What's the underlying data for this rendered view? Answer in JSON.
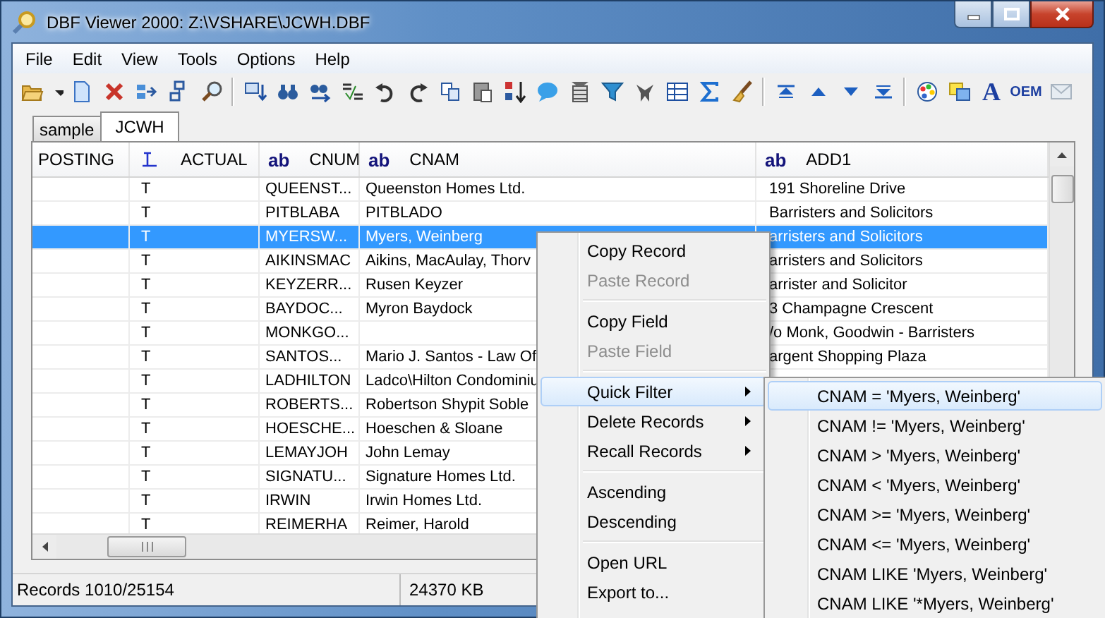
{
  "window": {
    "title": "DBF Viewer 2000: Z:\\VSHARE\\JCWH.DBF"
  },
  "menu_bar": [
    "File",
    "Edit",
    "View",
    "Tools",
    "Options",
    "Help"
  ],
  "toolbar": {
    "font_button": "A",
    "oem_button": "OEM"
  },
  "tabs": [
    {
      "label": "sample",
      "selected": false
    },
    {
      "label": "JCWH",
      "selected": true
    }
  ],
  "table": {
    "columns": [
      {
        "label": "POSTING",
        "kind": "plain"
      },
      {
        "label": "ACTUAL",
        "kind": "logical"
      },
      {
        "label": "CNUM",
        "kind": "text",
        "type_label": "ab"
      },
      {
        "label": "CNAM",
        "kind": "text",
        "type_label": "ab"
      },
      {
        "label": "ADD1",
        "kind": "text",
        "type_label": "ab"
      }
    ],
    "rows": [
      {
        "actual": "T",
        "cnum": "QUEENST...",
        "cnam": "Queenston Homes Ltd.",
        "add1": "191 Shoreline Drive",
        "selected": false
      },
      {
        "actual": "T",
        "cnum": "PITBLABA",
        "cnam": "PITBLADO",
        "add1": "Barristers and Solicitors",
        "selected": false
      },
      {
        "actual": "T",
        "cnum": "MYERSW...",
        "cnam": "Myers, Weinberg",
        "add1": "arristers and Solicitors",
        "selected": true
      },
      {
        "actual": "T",
        "cnum": "AIKINSMAC",
        "cnam": "Aikins, MacAulay, Thorv",
        "add1": "arristers and Solicitors",
        "selected": false
      },
      {
        "actual": "T",
        "cnum": "KEYZERR...",
        "cnam": "Rusen Keyzer",
        "add1": "arrister and Solicitor",
        "selected": false
      },
      {
        "actual": "T",
        "cnum": "BAYDOC...",
        "cnam": "Myron Baydock",
        "add1": "3 Champagne Crescent",
        "selected": false
      },
      {
        "actual": "T",
        "cnum": "MONKGO...",
        "add1": "/o Monk, Goodwin - Barristers",
        "selected": false
      },
      {
        "actual": "T",
        "cnum": "SANTOS...",
        "cnam": "Mario J. Santos - Law Of",
        "add1": "argent Shopping Plaza",
        "selected": false
      },
      {
        "actual": "T",
        "cnum": "LADHILTON",
        "cnam": "Ladco\\Hilton Condominiu",
        "selected": false
      },
      {
        "actual": "T",
        "cnum": "ROBERTS...",
        "cnam": "Robertson Shypit Soble",
        "selected": false
      },
      {
        "actual": "T",
        "cnum": "HOESCHE...",
        "cnam": "Hoeschen & Sloane",
        "selected": false
      },
      {
        "actual": "T",
        "cnum": "LEMAYJOH",
        "cnam": "John Lemay",
        "selected": false
      },
      {
        "actual": "T",
        "cnum": "SIGNATU...",
        "cnam": "Signature Homes Ltd.",
        "selected": false
      },
      {
        "actual": "T",
        "cnum": "IRWIN",
        "cnam": "Irwin Homes Ltd.",
        "selected": false
      },
      {
        "actual": "T",
        "cnum": "REIMERHA",
        "cnam": "Reimer, Harold",
        "selected": false
      }
    ]
  },
  "status_bar": {
    "records": "Records 1010/25154",
    "size": "24370 KB"
  },
  "context_menu": {
    "items": [
      {
        "kind": "item",
        "label": "Copy Record",
        "disabled": false,
        "submenu": false,
        "selected": false
      },
      {
        "kind": "item",
        "label": "Paste Record",
        "disabled": true,
        "submenu": false,
        "selected": false
      },
      {
        "kind": "separator"
      },
      {
        "kind": "item",
        "label": "Copy Field",
        "disabled": false,
        "submenu": false,
        "selected": false
      },
      {
        "kind": "item",
        "label": "Paste Field",
        "disabled": true,
        "submenu": false,
        "selected": false
      },
      {
        "kind": "separator"
      },
      {
        "kind": "item",
        "label": "Quick Filter",
        "disabled": false,
        "submenu": true,
        "selected": true
      },
      {
        "kind": "item",
        "label": "Delete Records",
        "disabled": false,
        "submenu": true,
        "selected": false
      },
      {
        "kind": "item",
        "label": "Recall Records",
        "disabled": false,
        "submenu": true,
        "selected": false
      },
      {
        "kind": "separator"
      },
      {
        "kind": "item",
        "label": "Ascending",
        "disabled": false,
        "submenu": false,
        "selected": false
      },
      {
        "kind": "item",
        "label": "Descending",
        "disabled": false,
        "submenu": false,
        "selected": false
      },
      {
        "kind": "separator"
      },
      {
        "kind": "item",
        "label": "Open URL",
        "disabled": false,
        "submenu": false,
        "selected": false
      },
      {
        "kind": "item",
        "label": "Export to...",
        "disabled": false,
        "submenu": false,
        "selected": false
      }
    ]
  },
  "submenu": {
    "items": [
      {
        "label": "CNAM = 'Myers, Weinberg'",
        "selected": true
      },
      {
        "label": "CNAM != 'Myers, Weinberg'",
        "selected": false
      },
      {
        "label": "CNAM > 'Myers, Weinberg'",
        "selected": false
      },
      {
        "label": "CNAM < 'Myers, Weinberg'",
        "selected": false
      },
      {
        "label": "CNAM >= 'Myers, Weinberg'",
        "selected": false
      },
      {
        "label": "CNAM <= 'Myers, Weinberg'",
        "selected": false
      },
      {
        "label": "CNAM LIKE 'Myers, Weinberg'",
        "selected": false
      },
      {
        "label": "CNAM LIKE '*Myers, Weinberg'",
        "selected": false
      }
    ]
  }
}
